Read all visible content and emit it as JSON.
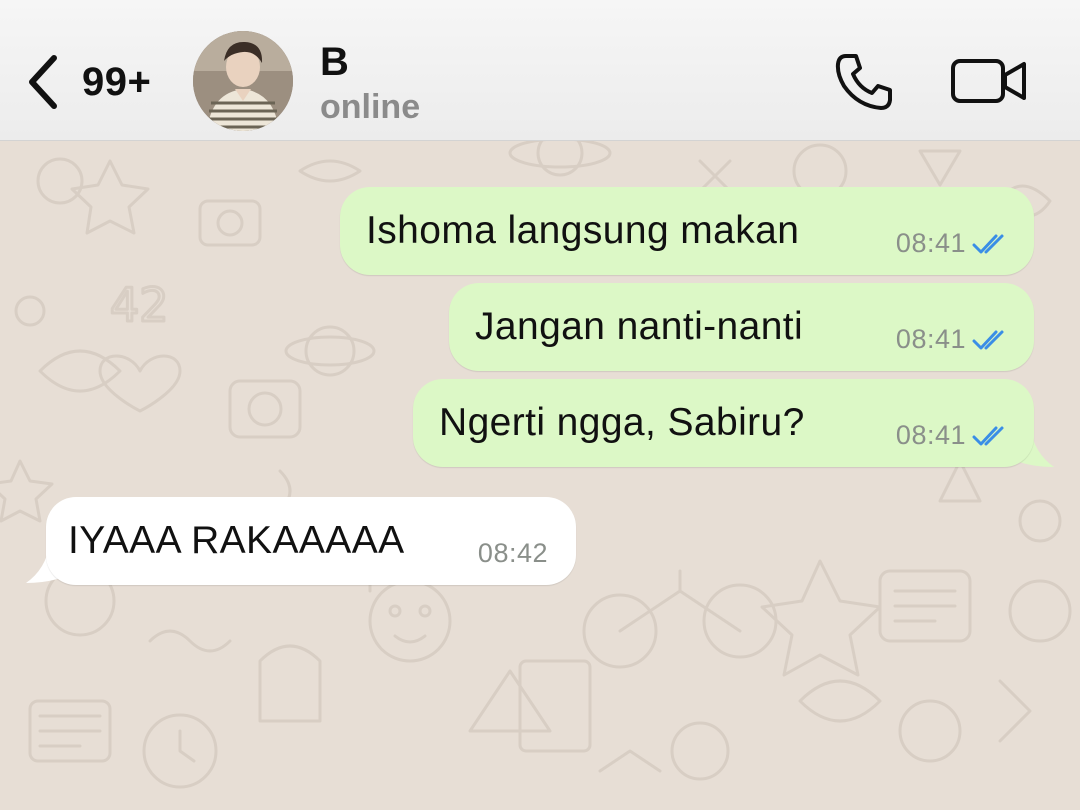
{
  "header": {
    "back_count": "99+",
    "contact_name": "B",
    "contact_status": "online",
    "icons": [
      "chevron-left-icon",
      "phone-icon",
      "video-camera-icon"
    ]
  },
  "messages": [
    {
      "direction": "outgoing",
      "text": "Ishoma langsung makan",
      "time": "08:41",
      "status": "read"
    },
    {
      "direction": "outgoing",
      "text": "Jangan nanti-nanti",
      "time": "08:41",
      "status": "read"
    },
    {
      "direction": "outgoing",
      "text": "Ngerti ngga, Sabiru?",
      "time": "08:41",
      "status": "read"
    },
    {
      "direction": "incoming",
      "text": "IYAAA RAKAAAAA",
      "time": "08:42"
    }
  ],
  "colors": {
    "outgoing_bubble": "#dcf8c6",
    "incoming_bubble": "#ffffff",
    "chat_background": "#e7ded5",
    "read_ticks": "#3a8ee6"
  }
}
